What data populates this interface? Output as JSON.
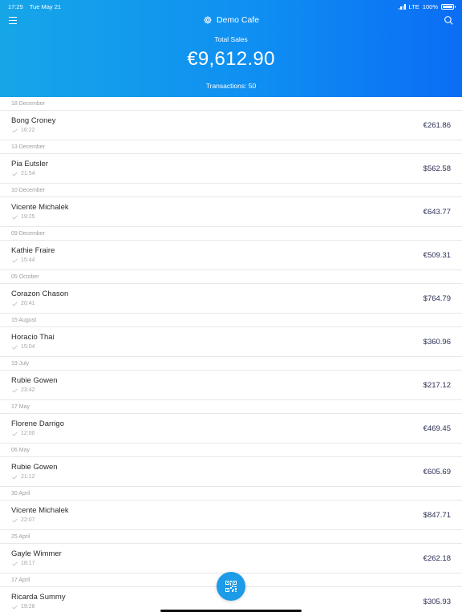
{
  "status_bar": {
    "time": "17:25",
    "date": "Tue May 21",
    "network": "LTE",
    "battery": "100%"
  },
  "header": {
    "brand_name": "Demo Cafe",
    "total_label": "Total Sales",
    "total_value": "€9,612.90",
    "transactions": "Transactions: 50"
  },
  "colors": {
    "header_start": "#16a6e8",
    "header_end": "#0b6df5",
    "amount_text": "#2b2f55",
    "fab": "#1b9be8"
  },
  "icons": {
    "menu": "hamburger-icon",
    "search": "search-icon",
    "brand": "gear-icon",
    "status": "check-icon",
    "fab": "qr-code-icon"
  },
  "groups": [
    {
      "date": "18 December",
      "name": "Bong Croney",
      "time": "16:22",
      "amount": "€261.86"
    },
    {
      "date": "13 December",
      "name": "Pia Eutsler",
      "time": "21:54",
      "amount": "$562.58"
    },
    {
      "date": "10 December",
      "name": "Vicente Michalek",
      "time": "19:25",
      "amount": "€643.77"
    },
    {
      "date": "09 December",
      "name": "Kathie Fraire",
      "time": "15:44",
      "amount": "€509.31"
    },
    {
      "date": "05 October",
      "name": "Corazon Chason",
      "time": "20:41",
      "amount": "$764.79"
    },
    {
      "date": "15 August",
      "name": "Horacio Thai",
      "time": "15:04",
      "amount": "$360.96"
    },
    {
      "date": "19 July",
      "name": "Rubie Gowen",
      "time": "23:42",
      "amount": "$217.12"
    },
    {
      "date": "17 May",
      "name": "Florene Darrigo",
      "time": "12:00",
      "amount": "€469.45"
    },
    {
      "date": "06 May",
      "name": "Rubie Gowen",
      "time": "21:12",
      "amount": "€605.69"
    },
    {
      "date": "30 April",
      "name": "Vicente Michalek",
      "time": "22:07",
      "amount": "$847.71"
    },
    {
      "date": "25 April",
      "name": "Gayle Wimmer",
      "time": "18:17",
      "amount": "€262.18"
    },
    {
      "date": "17 April",
      "name": "Ricarda Summy",
      "time": "19:28",
      "amount": "$305.93"
    }
  ]
}
